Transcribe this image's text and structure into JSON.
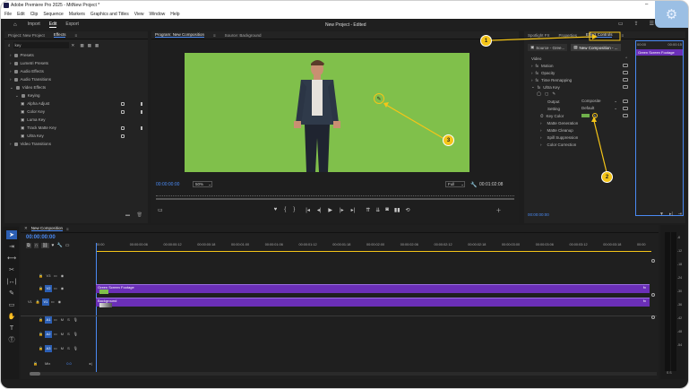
{
  "window": {
    "title": "Adobe Premiere Pro 2025 - MitNew Project *",
    "controls": [
      "–",
      "▢",
      "✕"
    ]
  },
  "menu": [
    "File",
    "Edit",
    "Clip",
    "Sequence",
    "Markers",
    "Graphics and Titles",
    "View",
    "Window",
    "Help"
  ],
  "workspace": {
    "tabs": [
      "Import",
      "Edit",
      "Export"
    ],
    "active_tab": "Edit",
    "project_title": "New Project - Edited"
  },
  "project_panel": {
    "tabs": [
      "Project: New Project",
      "Effects"
    ],
    "active_tab": "Effects",
    "search_value": "key",
    "tree": [
      {
        "label": "Presets",
        "level": 0
      },
      {
        "label": "Lumetri Presets",
        "level": 0
      },
      {
        "label": "Audio Effects",
        "level": 0
      },
      {
        "label": "Audio Transitions",
        "level": 0
      },
      {
        "label": "Video Effects",
        "level": 0
      },
      {
        "label": "Keying",
        "level": 1
      },
      {
        "label": "Alpha Adjust",
        "level": 2
      },
      {
        "label": "Color Key",
        "level": 2
      },
      {
        "label": "Luma Key",
        "level": 2
      },
      {
        "label": "Track Matte Key",
        "level": 2
      },
      {
        "label": "Ultra Key",
        "level": 2
      },
      {
        "label": "Video Transitions",
        "level": 0
      }
    ]
  },
  "program_monitor": {
    "tabs": [
      "Program: New Composition",
      "Source: Background"
    ],
    "active_tab": "Program: New Composition",
    "timecode": "00:00:00:00",
    "zoom": "50%",
    "quality": "Full",
    "duration": "00:01:02:08"
  },
  "effect_controls": {
    "tabs": [
      "Spotlight FX",
      "Properties",
      "Effect Controls"
    ],
    "active_tab": "Effect Controls",
    "source": "Source - Gree...",
    "sequence": "New Composition - ...",
    "timecode_start": "00:00",
    "timecode_end": "00:00:15",
    "clip_name": "Green Screen Footage",
    "section": "Video",
    "rows": [
      {
        "label": "Motion",
        "indent": 1
      },
      {
        "label": "Opacity",
        "indent": 1
      },
      {
        "label": "Time Remapping",
        "indent": 1
      },
      {
        "label": "Ultra Key",
        "indent": 1
      }
    ],
    "ultra_key": {
      "output_label": "Output",
      "output_value": "Composite",
      "setting_label": "Setting",
      "setting_value": "Default",
      "key_color_label": "Key Color",
      "key_color_hex": "#6fb04b",
      "subsections": [
        "Matte Generation",
        "Matte Cleanup",
        "Spill Suppression",
        "Color Correction"
      ]
    },
    "footer_timecode": "00:00:00:00"
  },
  "timeline": {
    "sequence_name": "New Composition",
    "timecode": "00:00:00:00",
    "ruler": [
      "00:00",
      "00:00:00:06",
      "00:00:00:12",
      "00:00:00:18",
      "00:00:01:00",
      "00:00:01:06",
      "00:00:01:12",
      "00:00:01:18",
      "00:00:02:00",
      "00:00:02:06",
      "00:00:02:12",
      "00:00:02:18",
      "00:00:03:00",
      "00:00:03:06",
      "00:00:03:12",
      "00:00:03:18",
      "00:00"
    ],
    "video_tracks": [
      "V3",
      "V2",
      "V1"
    ],
    "audio_tracks": [
      "A1",
      "A2",
      "A3"
    ],
    "mix_label": "Mix",
    "mix_value": "0.0",
    "clips": [
      {
        "name": "Green Screen Footage",
        "track": "V2"
      },
      {
        "name": "Background",
        "track": "V1"
      }
    ]
  },
  "audio_meter": {
    "db_marks": [
      "-6",
      "-12",
      "-18",
      "-24",
      "-30",
      "-36",
      "-42",
      "-48",
      "-54"
    ],
    "footer": "S S"
  },
  "annotations": [
    "1",
    "2",
    "3"
  ],
  "colors": {
    "accent_blue": "#2c5fb4",
    "clip_purple": "#6b2fb8",
    "green_screen": "#80c04b",
    "annotation_yellow": "#f5c518",
    "timecode_blue": "#4a8af4"
  }
}
